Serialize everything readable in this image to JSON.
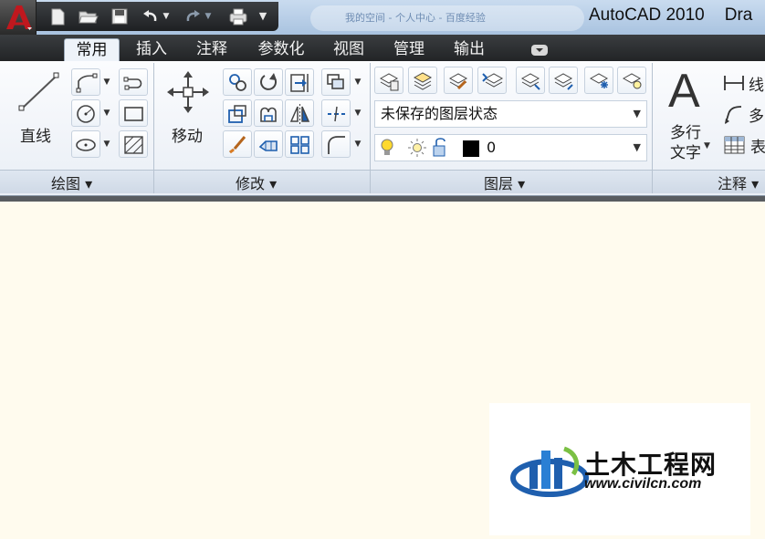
{
  "window": {
    "title": "AutoCAD 2010",
    "title_tail": "Dra",
    "background_tab": "我的空间 - 个人中心 - 百度经验"
  },
  "qat": {
    "items": [
      "new-icon",
      "open-icon",
      "save-icon",
      "undo-icon",
      "redo-icon",
      "plot-icon",
      "customize-dropdown-icon"
    ]
  },
  "tabs": [
    {
      "label": "常用",
      "active": true
    },
    {
      "label": "插入"
    },
    {
      "label": "注释"
    },
    {
      "label": "参数化"
    },
    {
      "label": "视图"
    },
    {
      "label": "管理"
    },
    {
      "label": "输出"
    }
  ],
  "panels": {
    "draw": {
      "title": "绘图 ▾",
      "line_label": "直线"
    },
    "modify": {
      "title": "修改 ▾",
      "move_label": "移动"
    },
    "layers": {
      "title": "图层 ▾",
      "state": "未保存的图层状态",
      "current_layer": "0",
      "layer_color": "#000000"
    },
    "annotation": {
      "title": "注释 ▾",
      "mtext_line1": "多行",
      "mtext_line2": "文字",
      "linear": "线",
      "multileader": "多",
      "table": "表"
    }
  },
  "watermark": {
    "brand": "土木工程网",
    "url": "www.civilcn.com"
  },
  "colors": {
    "accent": "#c0181e",
    "ribbon_dark": "#222426",
    "canvas": "#fffbee",
    "icon_blue": "#1f5fae"
  }
}
